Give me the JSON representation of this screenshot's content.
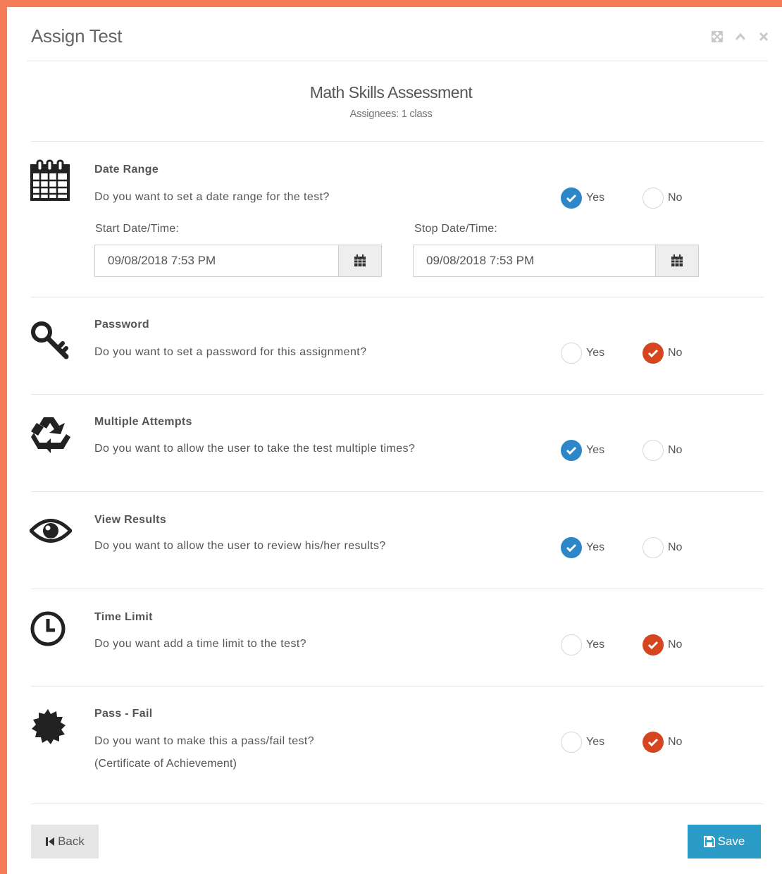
{
  "window": {
    "title": "Assign Test",
    "controls": [
      "expand-icon",
      "collapse-icon",
      "close-icon"
    ]
  },
  "test": {
    "name": "Math Skills Assessment",
    "assignees": "Assignees: 1 class"
  },
  "options": {
    "yes_label": "Yes",
    "no_label": "No"
  },
  "sections": {
    "date_range": {
      "icon": "calendar-icon",
      "title": "Date Range",
      "question": "Do you want to set a date range for the test?",
      "selected": "Yes",
      "start_label": "Start Date/Time:",
      "start_value": "09/08/2018 7:53 PM",
      "stop_label": "Stop Date/Time:",
      "stop_value": "09/08/2018 7:53 PM"
    },
    "password": {
      "icon": "key-icon",
      "title": "Password",
      "question": "Do you want to set a password for this assignment?",
      "selected": "No"
    },
    "multiple_attempts": {
      "icon": "recycle-icon",
      "title": "Multiple Attempts",
      "question": "Do you want to allow the user to take the test multiple times?",
      "selected": "Yes"
    },
    "view_results": {
      "icon": "eye-icon",
      "title": "View Results",
      "question": "Do you want to allow the user to review his/her results?",
      "selected": "Yes"
    },
    "time_limit": {
      "icon": "clock-icon",
      "title": "Time Limit",
      "question": "Do you want add a time limit to the test?",
      "selected": "No"
    },
    "pass_fail": {
      "icon": "certificate-icon",
      "title": "Pass - Fail",
      "question": "Do you want to make this a pass/fail test?",
      "note": "(Certificate of Achievement)",
      "selected": "No"
    }
  },
  "footer": {
    "back_label": "Back",
    "save_label": "Save"
  },
  "colors": {
    "frame": "#f47d57",
    "selected_yes": "#2d86c7",
    "selected_no": "#d5451f",
    "save_button": "#2b9bc8"
  }
}
